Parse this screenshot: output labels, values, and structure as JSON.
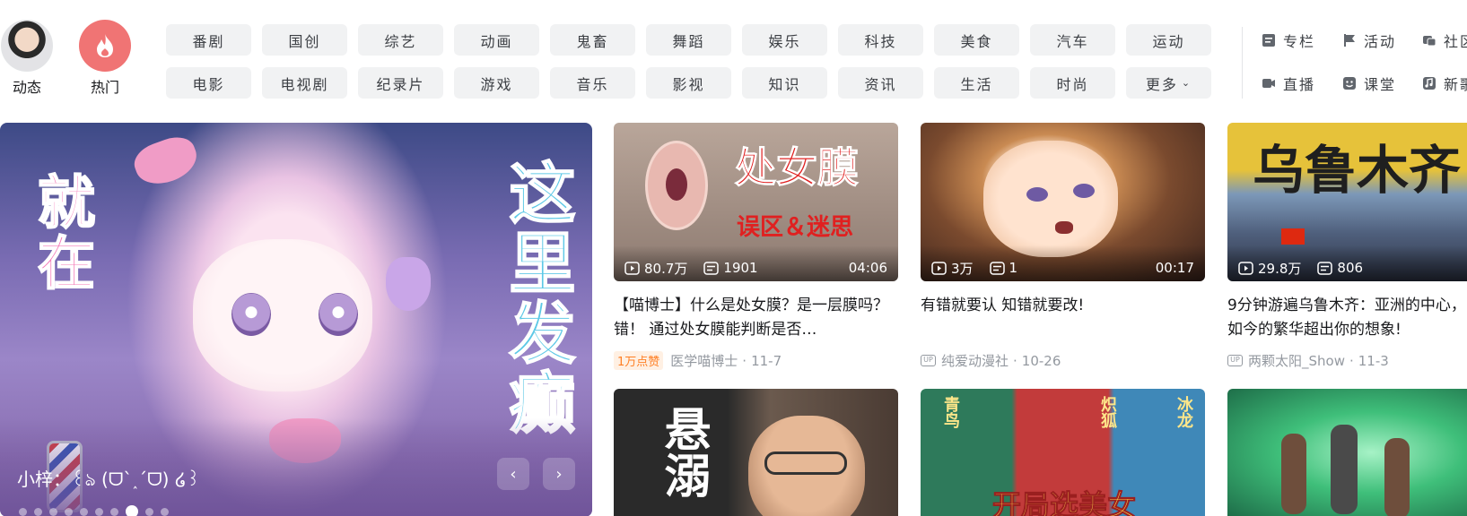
{
  "nav": {
    "dynamic_label": "动态",
    "hot_label": "热门",
    "channels_row1": [
      "番剧",
      "国创",
      "综艺",
      "动画",
      "鬼畜",
      "舞蹈",
      "娱乐",
      "科技",
      "美食",
      "汽车",
      "运动"
    ],
    "channels_row2": [
      "电影",
      "电视剧",
      "纪录片",
      "游戏",
      "音乐",
      "影视",
      "知识",
      "资讯",
      "生活",
      "时尚",
      "更多"
    ],
    "shortcuts": [
      {
        "label": "专栏",
        "icon": "article-icon"
      },
      {
        "label": "活动",
        "icon": "flag-icon"
      },
      {
        "label": "社区中心",
        "icon": "community-icon"
      },
      {
        "label": "直播",
        "icon": "live-icon"
      },
      {
        "label": "课堂",
        "icon": "classroom-icon"
      },
      {
        "label": "新歌热榜",
        "icon": "music-icon"
      }
    ]
  },
  "carousel": {
    "caption": "小梓：꒰ঌ (ᗜ`˰´ᗜ) ໒꒱",
    "left_text": "就在",
    "right_text": "这里发癫",
    "dot_count": 10,
    "active_dot": 7
  },
  "cards": [
    {
      "thumb_text_main": "处女膜",
      "thumb_text_sub": "误区＆迷思",
      "views": "80.7万",
      "danmaku": "1901",
      "duration": "04:06",
      "title": "【喵博士】什么是处女膜？是一层膜吗？错！ 通过处女膜能判断是否…",
      "badge": "1万点赞",
      "author": "医学喵博士",
      "date": "11-7"
    },
    {
      "views": "3万",
      "danmaku": "1",
      "duration": "00:17",
      "title": "有错就要认 知错就要改!",
      "author": "纯爱动漫社",
      "date": "10-26"
    },
    {
      "thumb_text_main": "乌鲁木齐",
      "views": "29.8万",
      "danmaku": "806",
      "duration": "",
      "title": "9分钟游遍乌鲁木齐：亚洲的中心，如今的繁华超出你的想象!",
      "author": "两颗太阳_Show",
      "date": "11-3"
    }
  ],
  "row2": {
    "card1_text": "悬溺",
    "card2_text": "开局选美女",
    "card2_tags": [
      "青鸟",
      "炽狐",
      "冰龙"
    ]
  }
}
